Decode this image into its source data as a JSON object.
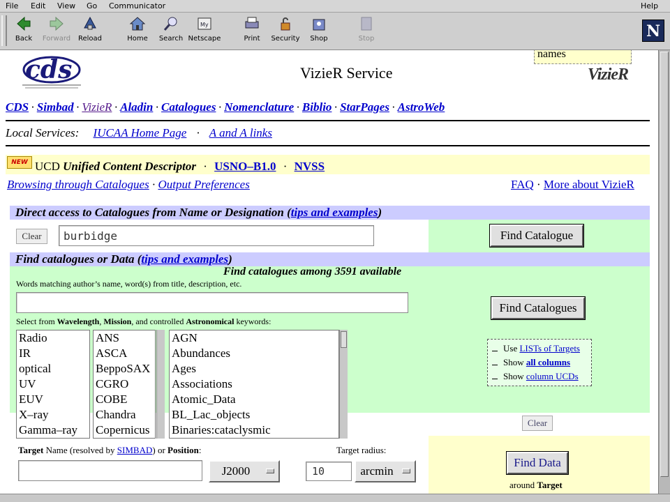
{
  "browser": {
    "menu": [
      "File",
      "Edit",
      "View",
      "Go",
      "Communicator",
      "Help"
    ],
    "toolbar": [
      {
        "label": "Back",
        "icon": "back-arrow-icon",
        "enabled": true
      },
      {
        "label": "Forward",
        "icon": "forward-arrow-icon",
        "enabled": false
      },
      {
        "label": "Reload",
        "icon": "reload-icon",
        "enabled": true
      },
      {
        "label": "Home",
        "icon": "home-icon",
        "enabled": true
      },
      {
        "label": "Search",
        "icon": "search-icon",
        "enabled": true
      },
      {
        "label": "Netscape",
        "icon": "netscape-icon",
        "enabled": true
      },
      {
        "label": "Print",
        "icon": "print-icon",
        "enabled": true
      },
      {
        "label": "Security",
        "icon": "lock-icon",
        "enabled": true
      },
      {
        "label": "Shop",
        "icon": "shop-icon",
        "enabled": true
      },
      {
        "label": "Stop",
        "icon": "stop-icon",
        "enabled": false
      }
    ],
    "logo_letter": "N"
  },
  "page": {
    "names_box": "names",
    "title": "VizieR Service",
    "vizier_logo": "VizieR",
    "nav": [
      "CDS",
      "Simbad",
      "VizieR",
      "Aladin",
      "Catalogues",
      "Nomenclature",
      "Biblio",
      "StarPages",
      "AstroWeb"
    ],
    "local_services": {
      "label": "Local Services:",
      "links": [
        "IUCAA Home Page",
        "A and A links"
      ]
    },
    "new_badge": "NEW",
    "ucd": {
      "prefix": "UCD",
      "text": "Unified Content Descriptor",
      "links": [
        "USNO–B1.0",
        "NVSS"
      ]
    },
    "browse_links": [
      "Browsing through Catalogues",
      "Output Preferences"
    ],
    "right_links": [
      "FAQ",
      "More about VizieR"
    ],
    "direct_access": {
      "heading": "Direct access to Catalogues from Name or Designation",
      "tips": "tips and examples",
      "clear": "Clear",
      "value": "burbidge",
      "button": "Find Catalogue"
    },
    "find_data": {
      "heading": "Find catalogues or Data",
      "tips": "tips and examples",
      "among": "Find catalogues among 3591 available",
      "words_label": "Words matching author’s name, word(s) from title, description, etc.",
      "words_value": "",
      "select_label_parts": [
        "Select from ",
        "Wavelength",
        ", ",
        "Mission",
        ", and controlled ",
        "Astronomical",
        " keywords:"
      ],
      "wavelengths": [
        "Radio",
        "IR",
        "optical",
        "UV",
        "EUV",
        "X–ray",
        "Gamma–ray"
      ],
      "missions": [
        "ANS",
        "ASCA",
        "BeppoSAX",
        "CGRO",
        "COBE",
        "Chandra",
        "Copernicus"
      ],
      "keywords": [
        "AGN",
        "Abundances",
        "Ages",
        "Associations",
        "Atomic_Data",
        "BL_Lac_objects",
        "Binaries:cataclysmic"
      ],
      "find_catalogues": "Find Catalogues",
      "options": [
        {
          "pre": "Use ",
          "link": "LISTs of Targets",
          "bold": false
        },
        {
          "pre": "Show ",
          "link": "all columns",
          "bold": true
        },
        {
          "pre": "Show ",
          "link": "column UCDs",
          "bold": true
        }
      ],
      "clear": "Clear"
    },
    "target": {
      "label_parts": [
        "Target",
        " Name (resolved by ",
        "SIMBAD",
        ") or ",
        "Position",
        ":"
      ],
      "radius_label": "Target radius:",
      "name_value": "",
      "equinox": "J2000",
      "radius": "10",
      "unit": "arcmin",
      "find_data": "Find Data",
      "around": "around ",
      "around_bold": "Target"
    }
  }
}
